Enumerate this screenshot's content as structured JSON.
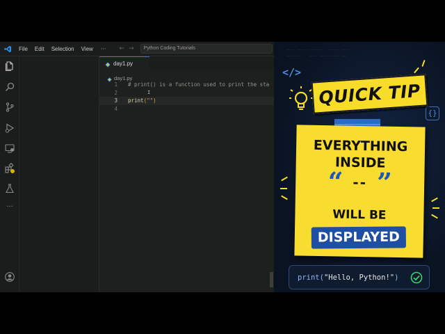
{
  "editor": {
    "menu": [
      "File",
      "Edit",
      "Selection",
      "View"
    ],
    "menu_more": "···",
    "nav_back": "←",
    "nav_forward": "→",
    "command_center": "Python Coding Tutorials",
    "tab_label": "day1.py",
    "breadcrumb": "day1.py",
    "line_numbers": [
      "1",
      "2",
      "3",
      "4"
    ],
    "line1_comment": "# print() is a function used to print the sta",
    "line3_fn": "print",
    "line3_open": "(",
    "line3_str": "\"\"",
    "line3_close": ")",
    "cursor_glyph": "I",
    "colors": {
      "accent": "#3a78d6",
      "editor_bg": "#1e1f1f",
      "python_icon": "#4a9be0"
    },
    "activity_icons": [
      "files-icon",
      "search-icon",
      "source-control-icon",
      "run-debug-icon",
      "remote-explorer-icon",
      "extensions-icon",
      "testing-icon",
      "more-icon",
      "account-icon",
      "settings-gear-icon"
    ]
  },
  "tip": {
    "html_icon": "</>",
    "brace_icon": "{}",
    "title": "QUICK TIP",
    "line1": "EVERYTHING",
    "line2": "INSIDE",
    "quote_open": "“",
    "quote_mid": "--",
    "quote_close": "”",
    "line4": "WILL BE",
    "badge": "DISPLAYED",
    "code_fn": "print(",
    "code_str": "\"Hello, Python!\"",
    "code_close": ")",
    "colors": {
      "note": "#f8dc2f",
      "badge": "#1e4fa3",
      "quotes": "#1f57b8",
      "check": "#3bd16f",
      "panel_bg": "#0a1322"
    }
  }
}
